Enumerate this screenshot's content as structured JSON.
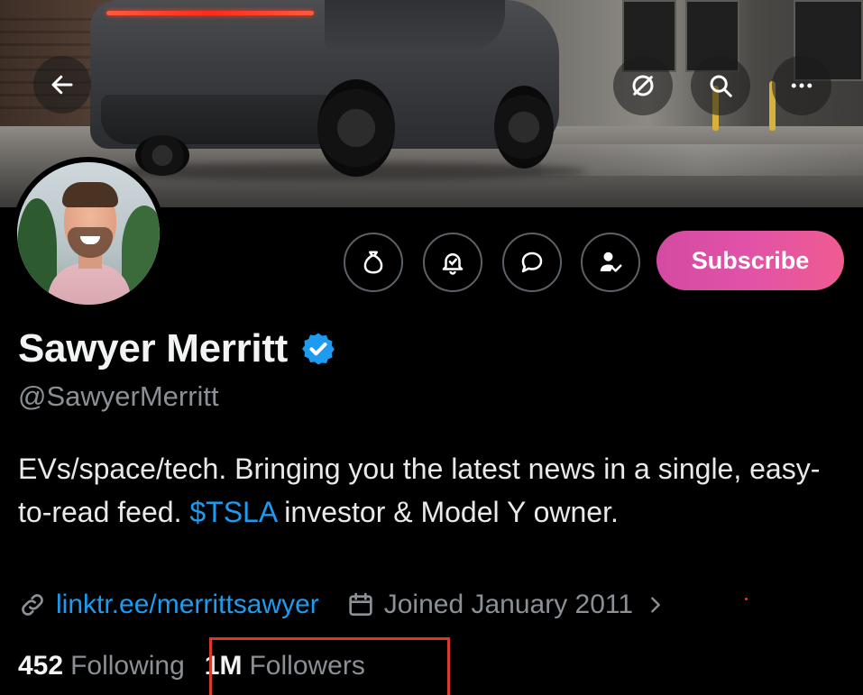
{
  "banner": {
    "back_icon": "arrow-left-icon",
    "action_icons": [
      "no-sync-icon",
      "search-icon",
      "more-icon"
    ]
  },
  "profile": {
    "display_name": "Sawyer Merritt",
    "handle": "@SawyerMerritt",
    "verified_icon": "verified-badge-icon",
    "bio_part1": "EVs/space/tech. Bringing you the latest news in a single, easy-to-read feed. ",
    "bio_cashtag": "$TSLA",
    "bio_part2": " investor & Model Y owner.",
    "link_text": "linktr.ee/merrittsawyer",
    "joined_text": "Joined January 2011",
    "following_count": "452",
    "following_label": "Following",
    "followers_count": "1M",
    "followers_label": "Followers"
  },
  "actions": {
    "icons": [
      "money-bag-icon",
      "bell-check-icon",
      "message-icon",
      "person-check-icon"
    ],
    "subscribe_label": "Subscribe"
  },
  "colors": {
    "accent": "#1d9bf0",
    "subscribe_gradient_start": "#d44aa2",
    "subscribe_gradient_end": "#ef5b92",
    "highlight": "#d63a2f"
  }
}
